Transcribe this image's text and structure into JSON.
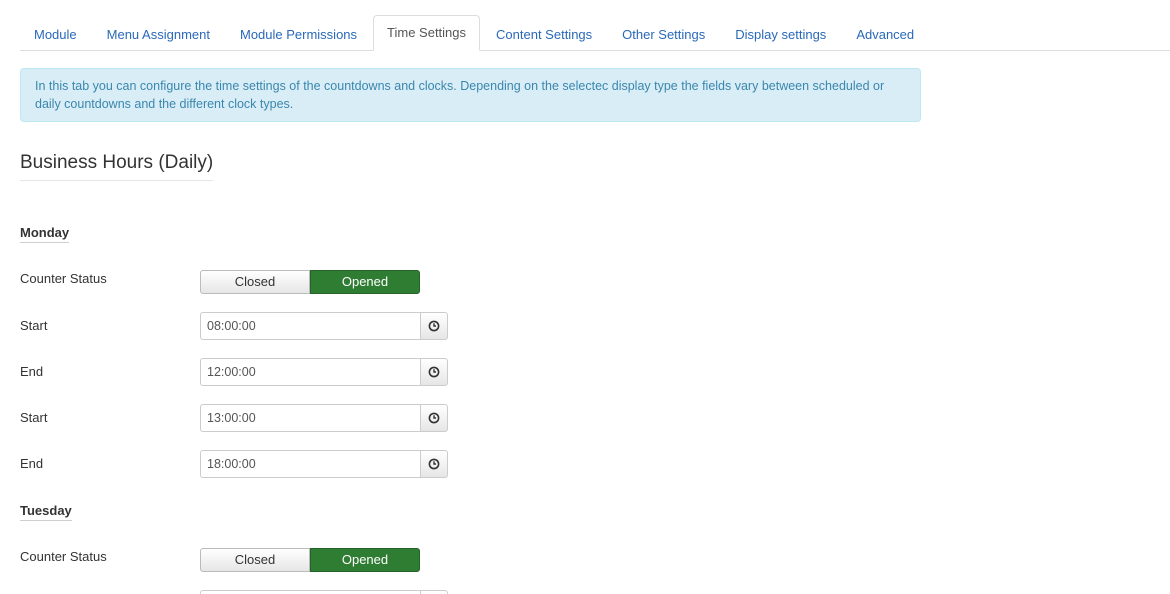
{
  "tabs": [
    {
      "label": "Module",
      "active": false
    },
    {
      "label": "Menu Assignment",
      "active": false
    },
    {
      "label": "Module Permissions",
      "active": false
    },
    {
      "label": "Time Settings",
      "active": true
    },
    {
      "label": "Content Settings",
      "active": false
    },
    {
      "label": "Other Settings",
      "active": false
    },
    {
      "label": "Display settings",
      "active": false
    },
    {
      "label": "Advanced",
      "active": false
    }
  ],
  "alert": {
    "text": "In this tab you can configure the time settings of the countdowns and clocks. Depending on the selectec display type the fields vary between scheduled or daily countdowns and the different clock types."
  },
  "section": {
    "title": "Business Hours (Daily)"
  },
  "days": [
    {
      "name": "Monday",
      "status_label": "Counter Status",
      "closed_label": "Closed",
      "opened_label": "Opened",
      "selected": "Opened",
      "slots": [
        {
          "label": "Start",
          "value": "08:00:00"
        },
        {
          "label": "End",
          "value": "12:00:00"
        },
        {
          "label": "Start",
          "value": "13:00:00"
        },
        {
          "label": "End",
          "value": "18:00:00"
        }
      ]
    },
    {
      "name": "Tuesday",
      "status_label": "Counter Status",
      "closed_label": "Closed",
      "opened_label": "Opened",
      "selected": "Opened",
      "slots": []
    }
  ],
  "icons": {
    "time_button": "clock-icon"
  },
  "colors": {
    "tab_link": "#2a69b8",
    "alert_bg": "#d9edf7",
    "alert_text": "#3a87ad",
    "opened_bg": "#2f7d32"
  }
}
